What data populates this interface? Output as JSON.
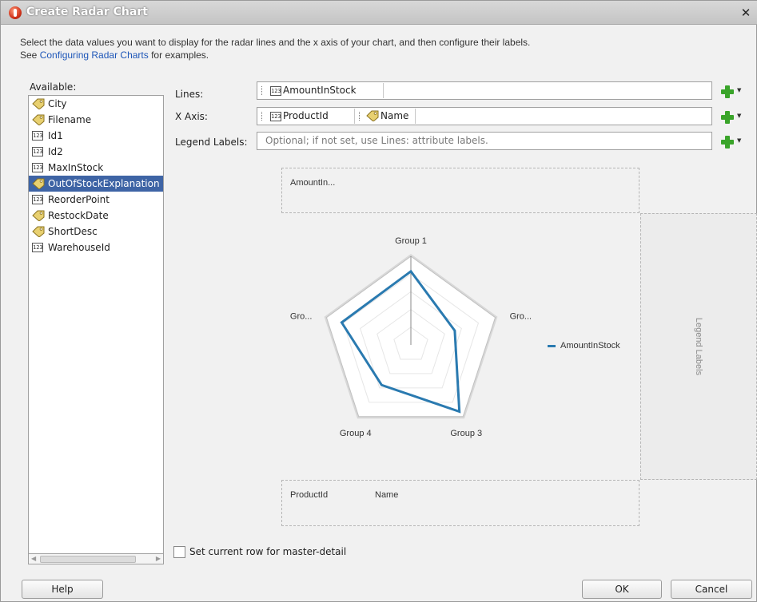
{
  "window": {
    "title": "Create Radar Chart"
  },
  "description": {
    "line1": "Select the data values you want to display for the radar lines and the x axis of your chart, and then configure their labels.",
    "line2_prefix": "See ",
    "link": "Configuring Radar Charts",
    "line2_suffix": " for examples."
  },
  "available": {
    "label": "Available:",
    "items": [
      {
        "label": "City",
        "icon": "tag-icon"
      },
      {
        "label": "Filename",
        "icon": "tag-icon"
      },
      {
        "label": "Id1",
        "icon": "number-icon"
      },
      {
        "label": "Id2",
        "icon": "number-icon"
      },
      {
        "label": "MaxInStock",
        "icon": "number-icon"
      },
      {
        "label": "OutOfStockExplanation",
        "icon": "tag-icon",
        "selected": true
      },
      {
        "label": "ReorderPoint",
        "icon": "number-icon"
      },
      {
        "label": "RestockDate",
        "icon": "tag-icon"
      },
      {
        "label": "ShortDesc",
        "icon": "tag-icon"
      },
      {
        "label": "WarehouseId",
        "icon": "number-icon"
      }
    ]
  },
  "fields": {
    "lines_label": "Lines:",
    "lines_value": "AmountInStock",
    "xaxis_label": "X Axis:",
    "xaxis_values": [
      "ProductId",
      "Name"
    ],
    "legend_label": "Legend Labels:",
    "legend_placeholder": "Optional; if not set, use Lines: attribute labels."
  },
  "preview": {
    "top_label": "AmountIn...",
    "bottom_labels": [
      "ProductId",
      "Name"
    ],
    "legend_side_label": "Legend Labels"
  },
  "chart_data": {
    "type": "radar",
    "categories": [
      "Group 1",
      "Gro...",
      "Group 3",
      "Group 4",
      "Gro..."
    ],
    "series": [
      {
        "name": "AmountInStock",
        "values": [
          0.83,
          0.52,
          0.93,
          0.56,
          0.82
        ],
        "color": "#2a7ab0"
      }
    ],
    "range": [
      0,
      1
    ],
    "rings": 5
  },
  "master_detail": {
    "label": "Set current row for master-detail",
    "checked": false
  },
  "buttons": {
    "help": "Help",
    "ok": "OK",
    "cancel": "Cancel"
  }
}
